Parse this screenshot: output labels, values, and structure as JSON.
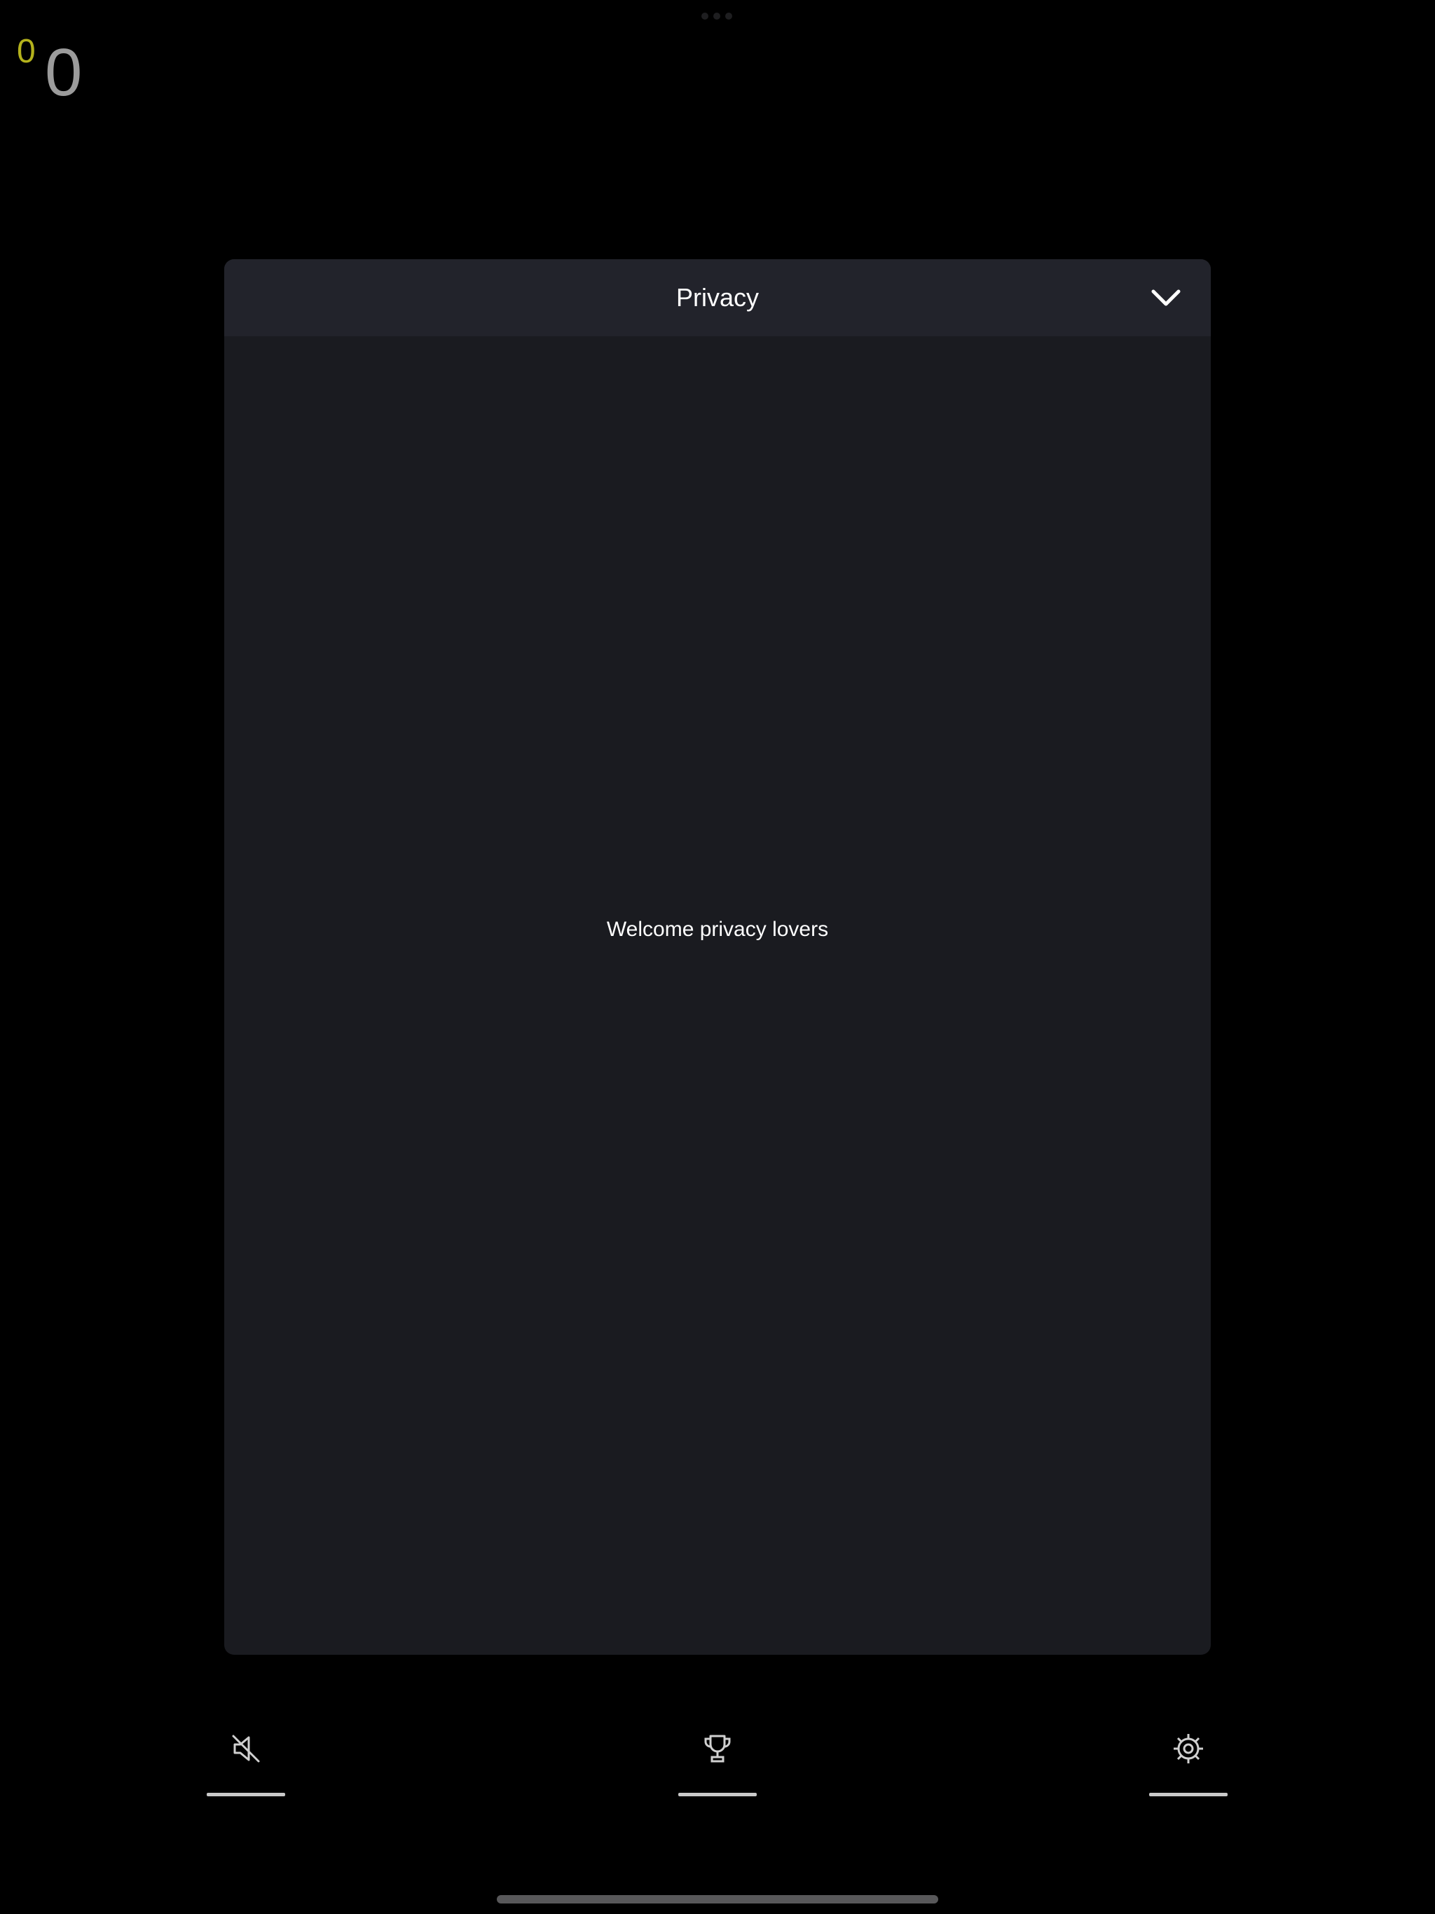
{
  "score": {
    "small": "0",
    "big": "0"
  },
  "modal": {
    "title": "Privacy",
    "close_icon": "chevron-down-icon",
    "message": "Welcome privacy lovers"
  },
  "toolbar": {
    "items": [
      {
        "icon": "speaker-muted-icon"
      },
      {
        "icon": "trophy-icon"
      },
      {
        "icon": "gear-icon"
      }
    ]
  },
  "colors": {
    "background": "#000000",
    "modal_bg": "#1a1b20",
    "modal_header_bg": "#22232b",
    "score_small": "#b4b21c",
    "score_big": "#9b9b9b",
    "text": "#ffffff"
  }
}
